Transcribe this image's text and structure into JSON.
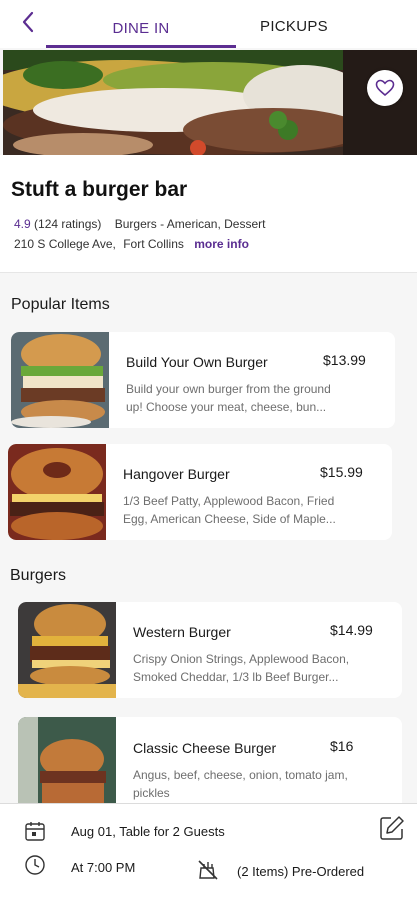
{
  "tabs": {
    "dine_in": "DINE IN",
    "pickups": "PICKUPS",
    "active": "DINE IN"
  },
  "colors": {
    "accent": "#5c2d91",
    "muted_text": "#6e6e6e"
  },
  "restaurant": {
    "name": "Stuft a burger bar",
    "rating": "4.9",
    "ratings_count": "(124 ratings)",
    "cuisines": "Burgers - American, Dessert",
    "address": "210 S College Ave,",
    "city": "Fort Collins",
    "more_info": "more info"
  },
  "popular": {
    "title": "Popular Items",
    "items": [
      {
        "name": "Build Your Own Burger",
        "price": "$13.99",
        "desc1": "Build your own burger from the ground",
        "desc2": "up! Choose your meat, cheese, bun..."
      },
      {
        "name": "Hangover Burger",
        "price": "$15.99",
        "desc1": "1/3 Beef Patty, Applewood Bacon, Fried",
        "desc2": "Egg, American Cheese, Side of Maple..."
      }
    ]
  },
  "burgers": {
    "title": "Burgers",
    "items": [
      {
        "name": "Western Burger",
        "price": "$14.99",
        "desc1": "Crispy Onion Strings, Applewood Bacon,",
        "desc2": "Smoked Cheddar, 1/3 lb Beef Burger..."
      },
      {
        "name": "Classic Cheese Burger",
        "price": "$16",
        "desc1": "Angus, beef, cheese, onion, tomato jam,",
        "desc2": "pickles"
      }
    ]
  },
  "order": {
    "date_table": "Aug 01, Table for 2 Guests",
    "time": "At 7:00 PM",
    "preordered": "(2 Items) Pre-Ordered"
  },
  "icons": [
    "back-arrow-icon",
    "heart-icon",
    "calendar-icon",
    "edit-icon",
    "clock-icon",
    "no-food-icon"
  ]
}
